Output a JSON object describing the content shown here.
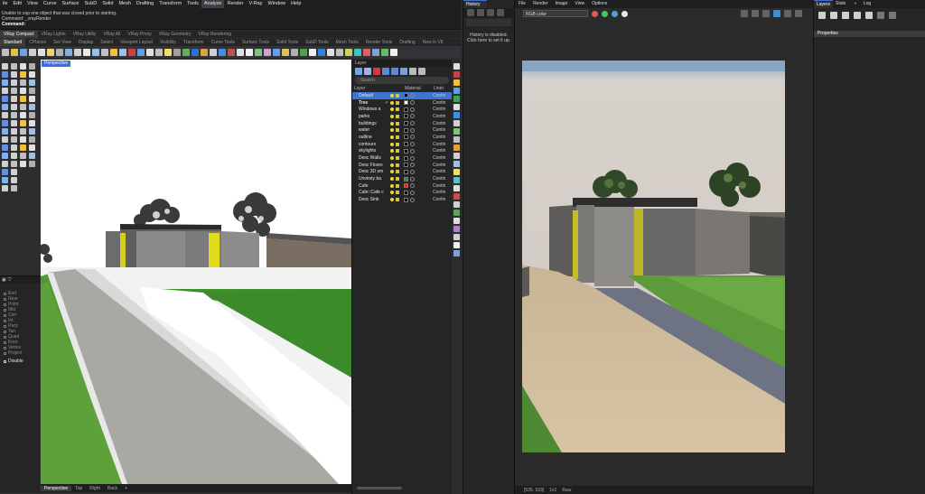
{
  "rhino": {
    "menu": [
      "ile",
      "Edit",
      "View",
      "Curve",
      "Surface",
      "SubD",
      "Solid",
      "Mesh",
      "Drafting",
      "Transform",
      "Tools",
      "Analyze",
      "Render",
      "V-Ray",
      "Window",
      "Help"
    ],
    "menu_active": "Analyze",
    "command_history": [
      "Unable to cap one object that was closed prior to starting.",
      "Command: _vrayRender"
    ],
    "command_prompt": "Command:",
    "toolbar_tabs_row1": [
      "VRay Compact",
      "VRay Lights",
      "VRay Utility",
      "VRay All",
      "VRay Proxy",
      "VRay Geometry",
      "VRay Rendering"
    ],
    "toolbar_tabs_row2": [
      "Standard",
      "CPlanes",
      "Set View",
      "Display",
      "Select",
      "Viewport Layout",
      "Visibility",
      "Transform",
      "Curve Tools",
      "Surface Tools",
      "Solid Tools",
      "SubD Tools",
      "Mesh Tools",
      "Render Tools",
      "Drafting",
      "New in V8"
    ],
    "viewport_label": "Perspective",
    "viewport_tabs": [
      "Perspective",
      "Top",
      "Right",
      "Back"
    ],
    "osnap": {
      "items": [
        "End",
        "Near",
        "Point",
        "Mid",
        "Cen",
        "Int",
        "Perp",
        "Tan",
        "Quad",
        "Knot",
        "Vertex",
        "Project"
      ],
      "disable_label": "Disable"
    },
    "layers": {
      "title": "Layer",
      "search_placeholder": "Search",
      "columns": {
        "name": "Layer",
        "material": "Material",
        "linetype": "Linet"
      },
      "rows": [
        {
          "name": "Default",
          "current": false,
          "color": "#000000",
          "linetype": "Contin",
          "selected": true
        },
        {
          "name": "Tree",
          "current": true,
          "color": "#ffffff",
          "linetype": "Contin",
          "selected": false
        },
        {
          "name": "Windows a",
          "current": false,
          "color": "#000000",
          "linetype": "Contin",
          "selected": false
        },
        {
          "name": "parks",
          "current": false,
          "color": "#000000",
          "linetype": "Contin",
          "selected": false
        },
        {
          "name": "buildings",
          "current": false,
          "color": "#000000",
          "linetype": "Contin",
          "selected": false
        },
        {
          "name": "water",
          "current": false,
          "color": "#000000",
          "linetype": "Contin",
          "selected": false
        },
        {
          "name": "outline",
          "current": false,
          "color": "#000000",
          "linetype": "Contin",
          "selected": false
        },
        {
          "name": "contours",
          "current": false,
          "color": "#000000",
          "linetype": "Contin",
          "selected": false
        },
        {
          "name": "skylights",
          "current": false,
          "color": "#000000",
          "linetype": "Contin",
          "selected": false
        },
        {
          "name": "Desc Walls",
          "current": false,
          "color": "#000000",
          "linetype": "Contin",
          "selected": false
        },
        {
          "name": "Desc Floors",
          "current": false,
          "color": "#000000",
          "linetype": "Contin",
          "selected": false
        },
        {
          "name": "Desc 3D sm",
          "current": false,
          "color": "#000000",
          "linetype": "Contin",
          "selected": false
        },
        {
          "name": "Unvirsty ba",
          "current": false,
          "color": "#2e8b3a",
          "linetype": "Contin",
          "selected": false
        },
        {
          "name": "Cafe",
          "current": false,
          "color": "#d93030",
          "linetype": "Contin",
          "selected": false
        },
        {
          "name": "Cafe::Cafe c",
          "current": false,
          "color": "#000000",
          "linetype": "Contin",
          "selected": false
        },
        {
          "name": "Desc Sink",
          "current": false,
          "color": "#000000",
          "linetype": "Contin",
          "selected": false
        }
      ]
    }
  },
  "history": {
    "tab": "History",
    "search_placeholder": "",
    "message": "History is disabled. Click here to set it up."
  },
  "vfb": {
    "menu": [
      "File",
      "Render",
      "Image",
      "View",
      "Options"
    ],
    "channel": "RGB color",
    "status": [
      "[535, 533]",
      "1x1",
      "Raw"
    ],
    "colors": {
      "red_dot": "#e05a5a",
      "green_dot": "#49c46b",
      "blue_dot": "#4aa3e0"
    }
  },
  "props": {
    "tabs": [
      "Layers",
      "Stats",
      "Log"
    ],
    "active_tab": "Layers",
    "header": "Properties"
  },
  "colors": {
    "accent": "#3a6ed8",
    "selection": "#3b74d3"
  }
}
